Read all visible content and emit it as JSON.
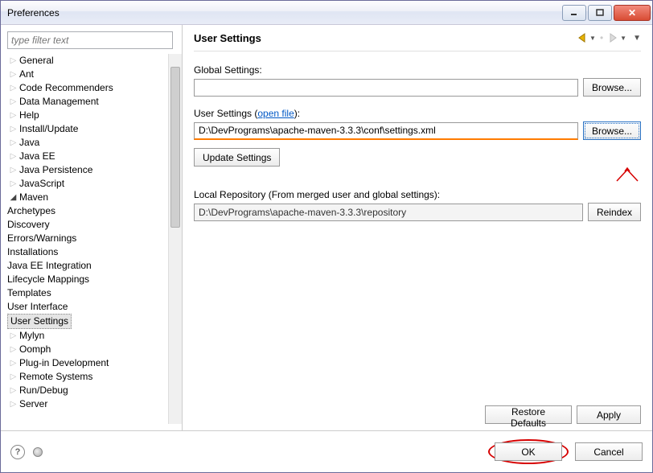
{
  "window": {
    "title": "Preferences"
  },
  "filter": {
    "placeholder": "type filter text"
  },
  "tree": {
    "items": [
      {
        "label": "General",
        "expandable": true
      },
      {
        "label": "Ant",
        "expandable": true
      },
      {
        "label": "Code Recommenders",
        "expandable": true
      },
      {
        "label": "Data Management",
        "expandable": true
      },
      {
        "label": "Help",
        "expandable": true
      },
      {
        "label": "Install/Update",
        "expandable": true
      },
      {
        "label": "Java",
        "expandable": true
      },
      {
        "label": "Java EE",
        "expandable": true
      },
      {
        "label": "Java Persistence",
        "expandable": true
      },
      {
        "label": "JavaScript",
        "expandable": true
      },
      {
        "label": "Maven",
        "expandable": true,
        "expanded": true,
        "children": [
          {
            "label": "Archetypes"
          },
          {
            "label": "Discovery"
          },
          {
            "label": "Errors/Warnings"
          },
          {
            "label": "Installations"
          },
          {
            "label": "Java EE Integration"
          },
          {
            "label": "Lifecycle Mappings"
          },
          {
            "label": "Templates"
          },
          {
            "label": "User Interface"
          },
          {
            "label": "User Settings",
            "selected": true
          }
        ]
      },
      {
        "label": "Mylyn",
        "expandable": true
      },
      {
        "label": "Oomph",
        "expandable": true
      },
      {
        "label": "Plug-in Development",
        "expandable": true
      },
      {
        "label": "Remote Systems",
        "expandable": true
      },
      {
        "label": "Run/Debug",
        "expandable": true
      },
      {
        "label": "Server",
        "expandable": true
      }
    ]
  },
  "page": {
    "title": "User Settings",
    "globalSettings": {
      "label": "Global Settings:",
      "value": "",
      "browse": "Browse..."
    },
    "userSettings": {
      "label": "User Settings",
      "openFile": "open file",
      "value": "D:\\DevPrograms\\apache-maven-3.3.3\\conf\\settings.xml",
      "browse": "Browse..."
    },
    "updateBtn": "Update Settings",
    "localRepo": {
      "label": "Local Repository (From merged user and global settings):",
      "value": "D:\\DevPrograms\\apache-maven-3.3.3\\repository",
      "reindex": "Reindex"
    },
    "restore": "Restore Defaults",
    "apply": "Apply"
  },
  "footer": {
    "ok": "OK",
    "cancel": "Cancel"
  }
}
